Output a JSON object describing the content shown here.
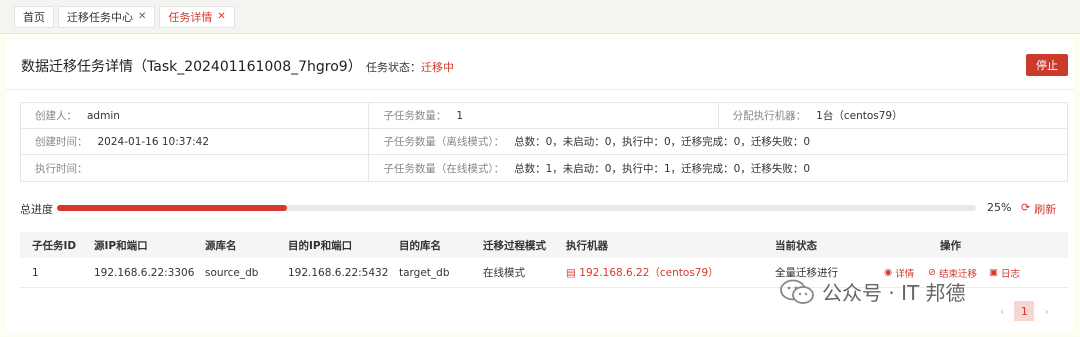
{
  "tabs": [
    {
      "label": "首页",
      "closable": false
    },
    {
      "label": "迁移任务中心",
      "closable": true
    },
    {
      "label": "任务详情",
      "closable": true,
      "active": true
    }
  ],
  "header": {
    "title": "数据迁移任务详情（Task_202401161008_7hgro9）",
    "status_label": "任务状态：",
    "status_value": "迁移中",
    "stop_label": "停止"
  },
  "info": {
    "creator_label": "创建人：",
    "creator": "admin",
    "subtask_count_label": "子任务数量：",
    "subtask_count": "1",
    "machine_label": "分配执行机器：",
    "machine": "1台（centos79）",
    "created_label": "创建时间：",
    "created": "2024-01-16 10:37:42",
    "offline_label": "子任务数量（离线模式）：",
    "offline": "总数：0，未启动：0，执行中：0，迁移完成：0，迁移失败：0",
    "exec_time_label": "执行时间：",
    "exec_time": "",
    "online_label": "子任务数量（在线模式）：",
    "online": "总数：1，未启动：0，执行中：1，迁移完成：0，迁移失败：0"
  },
  "progress": {
    "label": "总进度",
    "percent": 25,
    "percent_text": "25%",
    "refresh_label": "刷新"
  },
  "table": {
    "headers": [
      "子任务ID",
      "源IP和端口",
      "源库名",
      "目的IP和端口",
      "目的库名",
      "迁移过程模式",
      "执行机器",
      "当前状态",
      "操作"
    ],
    "row": {
      "id": "1",
      "src": "192.168.6.22:3306",
      "src_db": "source_db",
      "dst": "192.168.6.22:5432",
      "dst_db": "target_db",
      "mode": "在线模式",
      "machine": "192.168.6.22（centos79）",
      "state": "全量迁移进行",
      "op_detail": "详情",
      "op_end": "结束迁移",
      "op_log": "日志"
    }
  },
  "watermark": {
    "text": "公众号 · IT 邦德"
  },
  "pager": {
    "page": "1"
  },
  "colors": {
    "accent": "#d4382c"
  }
}
